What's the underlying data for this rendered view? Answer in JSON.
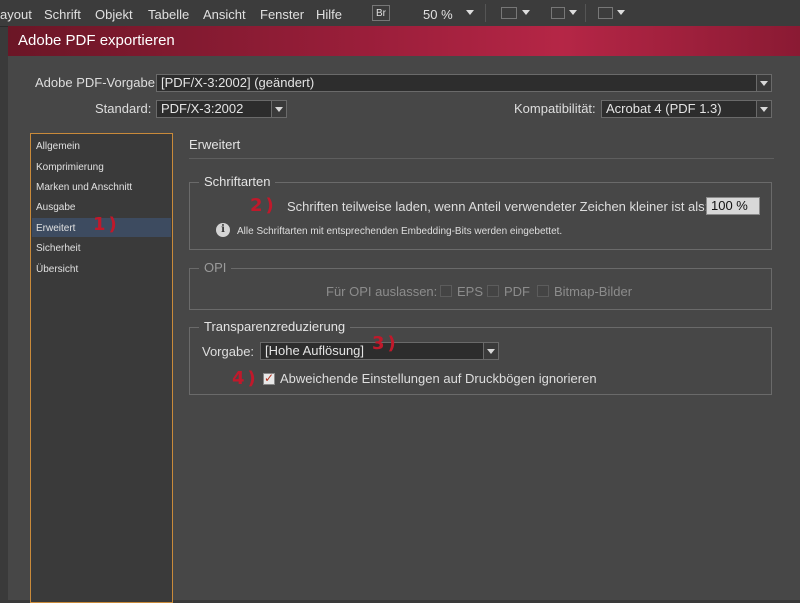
{
  "menubar": {
    "items": [
      "ayout",
      "Schrift",
      "Objekt",
      "Tabelle",
      "Ansicht",
      "Fenster",
      "Hilfe"
    ],
    "bridge_label": "Br",
    "zoom_value": "50 %"
  },
  "dialog": {
    "title": "Adobe PDF exportieren",
    "preset_label": "Adobe PDF-Vorgabe:",
    "preset_value": "[PDF/X-3:2002] (geändert)",
    "standard_label": "Standard:",
    "standard_value": "PDF/X-3:2002",
    "compat_label": "Kompatibilität:",
    "compat_value": "Acrobat 4 (PDF 1.3)"
  },
  "sidebar": {
    "items": [
      "Allgemein",
      "Komprimierung",
      "Marken und Anschnitt",
      "Ausgabe",
      "Erweitert",
      "Sicherheit",
      "Übersicht"
    ],
    "selected": "Erweitert"
  },
  "panel": {
    "heading": "Erweitert",
    "fonts": {
      "title": "Schriftarten",
      "subset_label": "Schriften teilweise laden, wenn Anteil verwendeter Zeichen kleiner ist als:",
      "subset_value": "100 %",
      "info_text": "Alle Schriftarten mit entsprechenden Embedding-Bits werden eingebettet."
    },
    "opi": {
      "title": "OPI",
      "omit_label": "Für OPI auslassen:",
      "options": [
        "EPS",
        "PDF",
        "Bitmap-Bilder"
      ]
    },
    "transparency": {
      "title": "Transparenzreduzierung",
      "preset_label": "Vorgabe:",
      "preset_value": "[Hohe Auflösung]",
      "ignore_label": "Abweichende Einstellungen auf Druckbögen ignorieren",
      "ignore_checked": true
    }
  },
  "annotations": {
    "m1": "1)",
    "m2": "2)",
    "m3": "3)",
    "m4": "4)",
    "color": "#c0192b"
  }
}
